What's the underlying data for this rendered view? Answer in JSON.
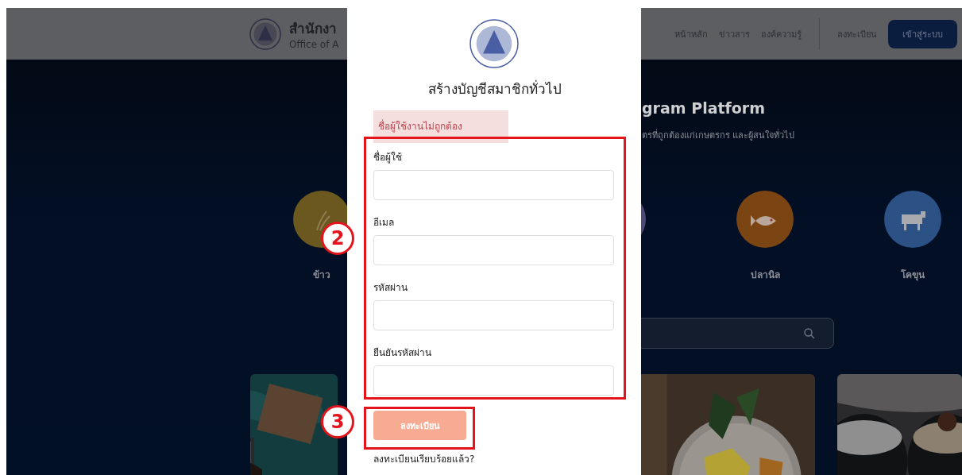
{
  "header": {
    "org_name": "สำนักงา",
    "org_subtitle": "Office of A",
    "nav": [
      "หน้าหลัก",
      "ข่าวสาร",
      "องค์ความรู้"
    ],
    "register_link": "ลงทะเบียน",
    "login_button": "เข้าสู่ระบบ"
  },
  "hero": {
    "title": "gram Platform",
    "subtitle": "ตรที่ถูกต้องแก่เกษตรกร และผู้สนใจทั่วไป"
  },
  "categories": [
    {
      "kind": "rice",
      "label": "ข้าว",
      "color": "#6b581e"
    },
    {
      "kind": "blank",
      "color": "#4e4877"
    },
    {
      "kind": "fish",
      "label": "ปลานิล",
      "color": "#7a4413"
    },
    {
      "kind": "cow",
      "label": "โคขุน",
      "color": "#2b5185"
    }
  ],
  "modal": {
    "title": "สร้างบัญชีสมาชิกทั่วไป",
    "error": "ชื่อผู้ใช้งานไม่ถูกต้อง",
    "fields": [
      {
        "label": "ชื่อผู้ใช้"
      },
      {
        "label": "อีเมล"
      },
      {
        "label": "รหัสผ่าน"
      },
      {
        "label": "ยืนยันรหัสผ่าน"
      }
    ],
    "submit_button": "ลงทะเบียน",
    "footer_link": "ลงทะเบียนเรียบร้อยแล้ว?"
  },
  "annotations": [
    {
      "number": "2"
    },
    {
      "number": "3"
    }
  ]
}
